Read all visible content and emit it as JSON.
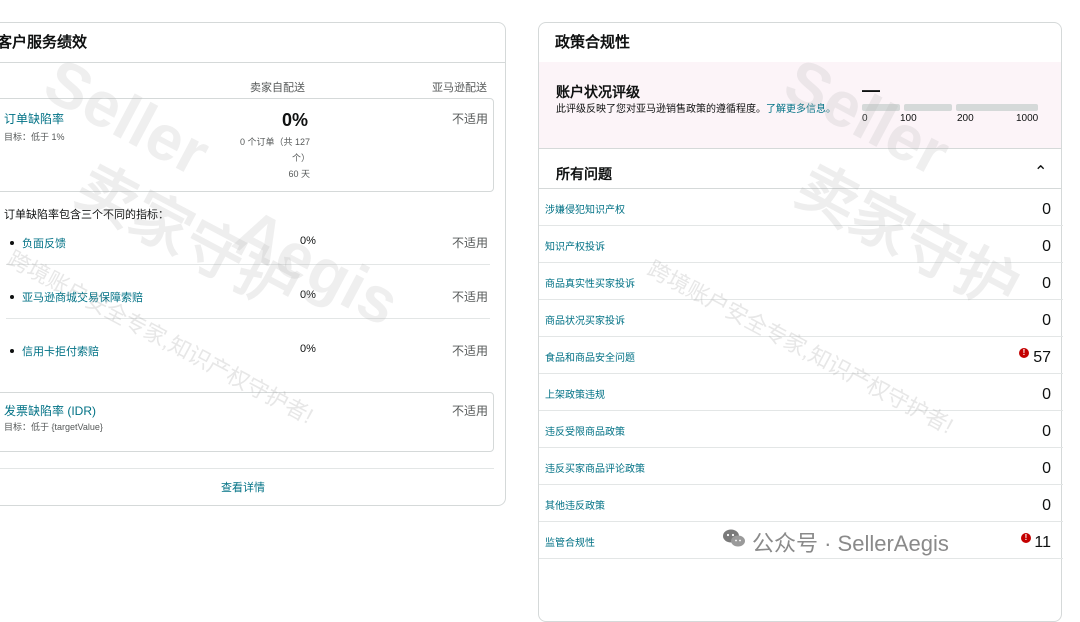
{
  "left_card": {
    "title": "客户服务绩效",
    "col_seller": "卖家自配送",
    "col_amazon": "亚马逊配送",
    "odr": {
      "title": "订单缺陷率",
      "target": "目标：低于 1%",
      "value": "0%",
      "detail_1": "0 个订单（共 127",
      "detail_2": "个）",
      "detail_3": "60 天",
      "amazon": "不适用"
    },
    "breakdown_label": "订单缺陷率包含三个不同的指标：",
    "sub_metrics": [
      {
        "label": "负面反馈",
        "value": "0%",
        "amazon": "不适用"
      },
      {
        "label": "亚马逊商城交易保障索赔",
        "value": "0%",
        "amazon": "不适用"
      },
      {
        "label": "信用卡拒付索赔",
        "value": "0%",
        "amazon": "不适用"
      }
    ],
    "idr": {
      "title": "发票缺陷率 (IDR)",
      "target": "目标：低于 {targetValue}",
      "amazon": "不适用"
    },
    "view_details": "查看详情"
  },
  "right_card": {
    "title": "政策合规性",
    "rating": {
      "title": "账户状况评级",
      "desc": "此评级反映了您对亚马逊销售政策的遵循程度。",
      "learn_more": "了解更多信息。",
      "value": "—",
      "scale": [
        "0",
        "100",
        "200",
        "1000"
      ]
    },
    "issues_title": "所有问题",
    "issues": [
      {
        "label": "涉嫌侵犯知识产权",
        "count": "0",
        "alert": false
      },
      {
        "label": "知识产权投诉",
        "count": "0",
        "alert": false
      },
      {
        "label": "商品真实性买家投诉",
        "count": "0",
        "alert": false
      },
      {
        "label": "商品状况买家投诉",
        "count": "0",
        "alert": false
      },
      {
        "label": "食品和商品安全问题",
        "count": "57",
        "alert": true
      },
      {
        "label": "上架政策违规",
        "count": "0",
        "alert": false
      },
      {
        "label": "违反受限商品政策",
        "count": "0",
        "alert": false
      },
      {
        "label": "违反买家商品评论政策",
        "count": "0",
        "alert": false
      },
      {
        "label": "其他违反政策",
        "count": "0",
        "alert": false
      },
      {
        "label": "监管合规性",
        "count": "11",
        "alert": true
      }
    ]
  },
  "watermark": {
    "brand_1": "Seller",
    "brand_2": "Aegis",
    "cn_1": "卖家守护",
    "cn_2": "卖家守护",
    "slogan_1": "跨境账户安全专家,知识产权守护者!",
    "slogan_2": "跨境账户安全专家,知识产权守护者!",
    "footer": "公众号 · SellerAegis"
  },
  "colors": {
    "link": "#007185",
    "alert": "#c40000",
    "border": "#d5d9d9",
    "rating_bg": "#fcf4f8"
  }
}
